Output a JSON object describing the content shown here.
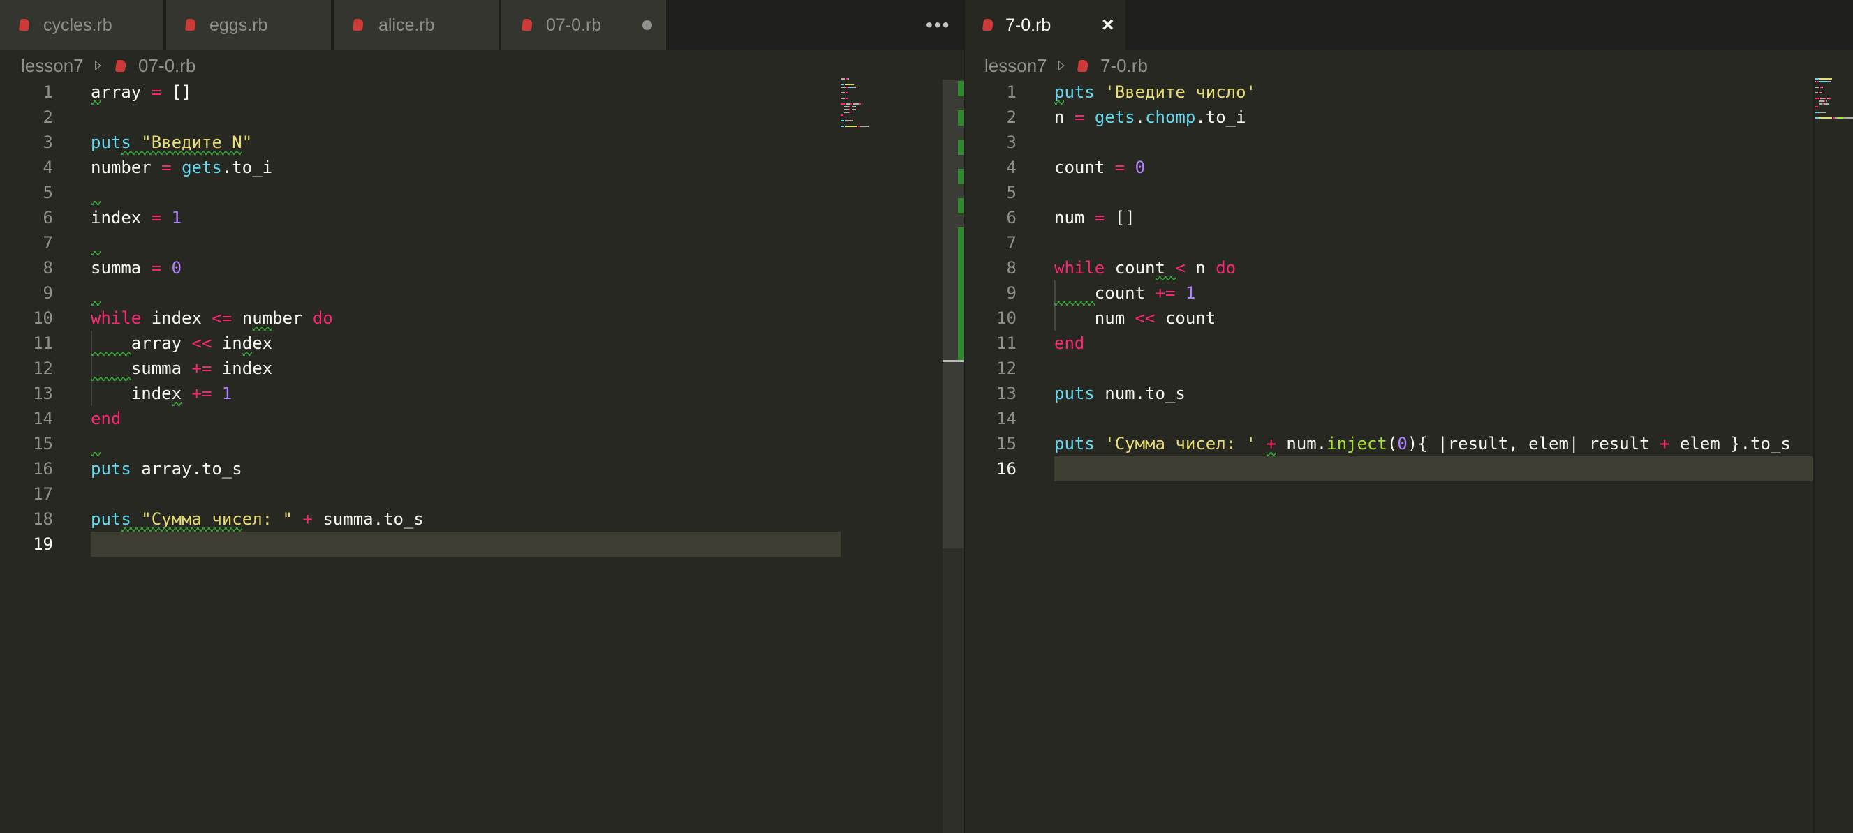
{
  "colors": {
    "background": "#272822",
    "tabbar": "#1e1f1c",
    "keyword": "#f92672",
    "string": "#e6db74",
    "builtin": "#66d9ef",
    "number": "#ae81ff",
    "method": "#a6e22e",
    "lint_squiggle": "#3aa53a",
    "git_added": "#2f8a2f"
  },
  "left_pane": {
    "tabs": [
      {
        "label": "cycles.rb",
        "icon": "ruby-file-icon",
        "active": false
      },
      {
        "label": "eggs.rb",
        "icon": "ruby-file-icon",
        "active": false
      },
      {
        "label": "alice.rb",
        "icon": "ruby-file-icon",
        "active": false
      },
      {
        "label": "07-0.rb",
        "icon": "ruby-file-icon",
        "active": true,
        "dirty": true
      }
    ],
    "more_icon": "ellipsis-icon",
    "more_label": "•••",
    "breadcrumb": {
      "folder": "lesson7",
      "file": "07-0.rb"
    },
    "current_line": 19,
    "lines": [
      {
        "n": "1",
        "tokens": [
          {
            "t": "array",
            "c": "id"
          },
          {
            "t": " = ",
            "c": "op"
          },
          {
            "t": "[]",
            "c": "id"
          }
        ]
      },
      {
        "n": "2",
        "tokens": []
      },
      {
        "n": "3",
        "tokens": [
          {
            "t": "puts",
            "c": "fn"
          },
          {
            "t": " ",
            "c": "id"
          },
          {
            "t": "\"Введите N\"",
            "c": "str"
          }
        ]
      },
      {
        "n": "4",
        "tokens": [
          {
            "t": "number",
            "c": "id"
          },
          {
            "t": " = ",
            "c": "op"
          },
          {
            "t": "gets",
            "c": "fn"
          },
          {
            "t": ".to_i",
            "c": "id"
          }
        ]
      },
      {
        "n": "5",
        "tokens": []
      },
      {
        "n": "6",
        "tokens": [
          {
            "t": "index",
            "c": "id"
          },
          {
            "t": " = ",
            "c": "op"
          },
          {
            "t": "1",
            "c": "num"
          }
        ]
      },
      {
        "n": "7",
        "tokens": []
      },
      {
        "n": "8",
        "tokens": [
          {
            "t": "summa",
            "c": "id"
          },
          {
            "t": " = ",
            "c": "op"
          },
          {
            "t": "0",
            "c": "num"
          }
        ]
      },
      {
        "n": "9",
        "tokens": []
      },
      {
        "n": "10",
        "tokens": [
          {
            "t": "while",
            "c": "kw"
          },
          {
            "t": " index ",
            "c": "id"
          },
          {
            "t": "<=",
            "c": "op"
          },
          {
            "t": " number ",
            "c": "id"
          },
          {
            "t": "do",
            "c": "kw"
          }
        ]
      },
      {
        "n": "11",
        "tokens": [
          {
            "t": "    array ",
            "c": "id"
          },
          {
            "t": "<<",
            "c": "op"
          },
          {
            "t": " index",
            "c": "id"
          }
        ]
      },
      {
        "n": "12",
        "tokens": [
          {
            "t": "    summa ",
            "c": "id"
          },
          {
            "t": "+=",
            "c": "op"
          },
          {
            "t": " index",
            "c": "id"
          }
        ]
      },
      {
        "n": "13",
        "tokens": [
          {
            "t": "    index ",
            "c": "id"
          },
          {
            "t": "+=",
            "c": "op"
          },
          {
            "t": " ",
            "c": "id"
          },
          {
            "t": "1",
            "c": "num"
          }
        ]
      },
      {
        "n": "14",
        "tokens": [
          {
            "t": "end",
            "c": "kw"
          }
        ]
      },
      {
        "n": "15",
        "tokens": []
      },
      {
        "n": "16",
        "tokens": [
          {
            "t": "puts",
            "c": "fn"
          },
          {
            "t": " array.to_s",
            "c": "id"
          }
        ]
      },
      {
        "n": "17",
        "tokens": []
      },
      {
        "n": "18",
        "tokens": [
          {
            "t": "puts",
            "c": "fn"
          },
          {
            "t": " ",
            "c": "id"
          },
          {
            "t": "\"Сумма чисел: \"",
            "c": "str"
          },
          {
            "t": " + ",
            "c": "op"
          },
          {
            "t": "summa.to_s",
            "c": "id"
          }
        ]
      },
      {
        "n": "19",
        "tokens": []
      }
    ]
  },
  "right_pane": {
    "tabs": [
      {
        "label": "7-0.rb",
        "icon": "ruby-file-icon",
        "active": true,
        "close": "×"
      }
    ],
    "breadcrumb": {
      "folder": "lesson7",
      "file": "7-0.rb"
    },
    "current_line": 16,
    "lines": [
      {
        "n": "1",
        "tokens": [
          {
            "t": "puts",
            "c": "fn"
          },
          {
            "t": " ",
            "c": "id"
          },
          {
            "t": "'Введите число'",
            "c": "str"
          }
        ]
      },
      {
        "n": "2",
        "tokens": [
          {
            "t": "n",
            "c": "id"
          },
          {
            "t": " = ",
            "c": "op"
          },
          {
            "t": "gets",
            "c": "fn"
          },
          {
            "t": ".",
            "c": "id"
          },
          {
            "t": "chomp",
            "c": "fn"
          },
          {
            "t": ".to_i",
            "c": "id"
          }
        ]
      },
      {
        "n": "3",
        "tokens": []
      },
      {
        "n": "4",
        "tokens": [
          {
            "t": "count",
            "c": "id"
          },
          {
            "t": " = ",
            "c": "op"
          },
          {
            "t": "0",
            "c": "num"
          }
        ]
      },
      {
        "n": "5",
        "tokens": []
      },
      {
        "n": "6",
        "tokens": [
          {
            "t": "num",
            "c": "id"
          },
          {
            "t": " = ",
            "c": "op"
          },
          {
            "t": "[]",
            "c": "id"
          }
        ]
      },
      {
        "n": "7",
        "tokens": []
      },
      {
        "n": "8",
        "tokens": [
          {
            "t": "while",
            "c": "kw"
          },
          {
            "t": " count ",
            "c": "id"
          },
          {
            "t": "<",
            "c": "op"
          },
          {
            "t": " n ",
            "c": "id"
          },
          {
            "t": "do",
            "c": "kw"
          }
        ]
      },
      {
        "n": "9",
        "tokens": [
          {
            "t": "    count ",
            "c": "id"
          },
          {
            "t": "+=",
            "c": "op"
          },
          {
            "t": " ",
            "c": "id"
          },
          {
            "t": "1",
            "c": "num"
          }
        ]
      },
      {
        "n": "10",
        "tokens": [
          {
            "t": "    num ",
            "c": "id"
          },
          {
            "t": "<<",
            "c": "op"
          },
          {
            "t": " count",
            "c": "id"
          }
        ]
      },
      {
        "n": "11",
        "tokens": [
          {
            "t": "end",
            "c": "kw"
          }
        ]
      },
      {
        "n": "12",
        "tokens": []
      },
      {
        "n": "13",
        "tokens": [
          {
            "t": "puts",
            "c": "fn"
          },
          {
            "t": " num.to_s",
            "c": "id"
          }
        ]
      },
      {
        "n": "14",
        "tokens": []
      },
      {
        "n": "15",
        "tokens": [
          {
            "t": "puts",
            "c": "fn"
          },
          {
            "t": " ",
            "c": "id"
          },
          {
            "t": "'Сумма чисел: '",
            "c": "str"
          },
          {
            "t": " + ",
            "c": "op"
          },
          {
            "t": "num.",
            "c": "id"
          },
          {
            "t": "inject",
            "c": "meth"
          },
          {
            "t": "(",
            "c": "id"
          },
          {
            "t": "0",
            "c": "num"
          },
          {
            "t": "){ |result, elem| result ",
            "c": "id"
          },
          {
            "t": "+",
            "c": "op"
          },
          {
            "t": " elem }.to_s",
            "c": "id"
          }
        ]
      },
      {
        "n": "16",
        "tokens": []
      }
    ]
  }
}
